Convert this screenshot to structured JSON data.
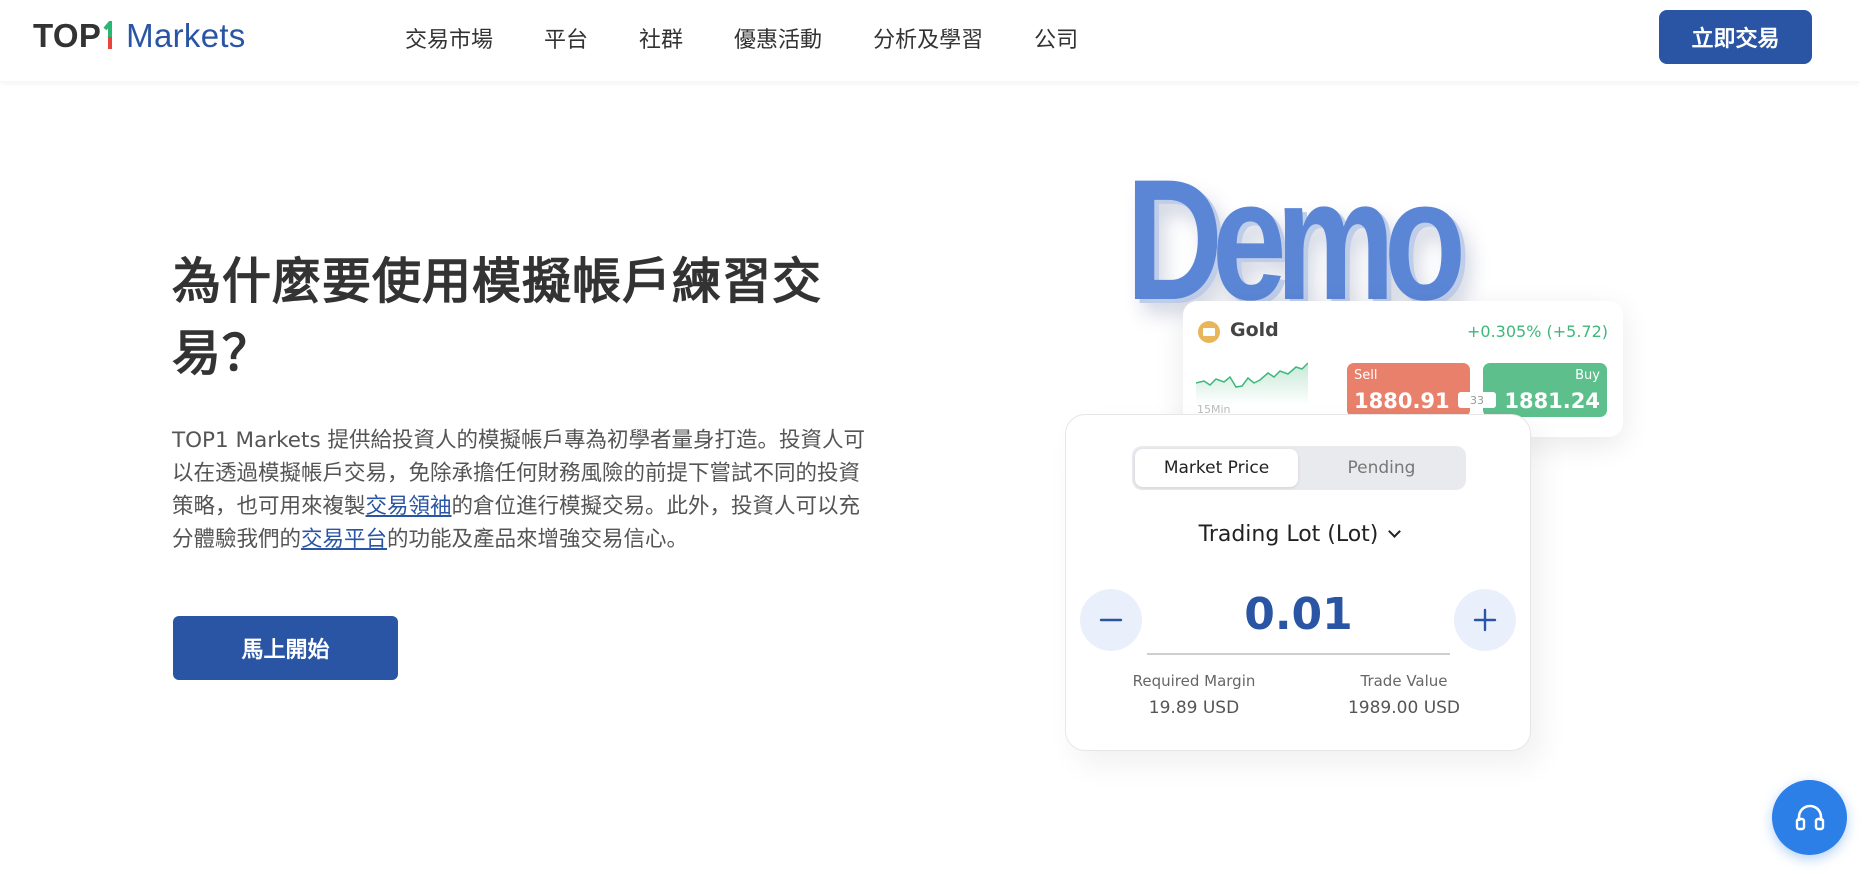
{
  "brand": {
    "top": "TOP",
    "markets": "Markets"
  },
  "nav": {
    "items": [
      {
        "label": "交易市場"
      },
      {
        "label": "平台"
      },
      {
        "label": "社群"
      },
      {
        "label": "優惠活動"
      },
      {
        "label": "分析及學習"
      },
      {
        "label": "公司"
      }
    ],
    "cta": "立即交易"
  },
  "hero": {
    "title": "為什麼要使用模擬帳戶練習交易？",
    "para_part1": "TOP1 Markets 提供給投資人的模擬帳戶專為初學者量身打造。投資人可以在透過模擬帳戶交易，免除承擔任何財務風險的前提下嘗試不同的投資策略，也可用來複製",
    "link1": "交易領袖",
    "para_part2": "的倉位進行模擬交易。此外，投資人可以充分體驗我們的",
    "link2": "交易平台",
    "para_part3": "的功能及產品來增強交易信心。",
    "start_button": "馬上開始"
  },
  "illustration": {
    "demo_word": "Demo",
    "quote": {
      "symbol": "Gold",
      "change": "+0.305% (+5.72)",
      "timeframe": "15Min",
      "sell_label": "Sell",
      "sell_price": "1880.91",
      "buy_label": "Buy",
      "buy_price": "1881.24",
      "spread": "33"
    },
    "order": {
      "tab_active": "Market Price",
      "tab_inactive": "Pending",
      "lot_label": "Trading Lot (Lot)",
      "lot_value": "0.01",
      "margin_label": "Required Margin",
      "margin_value": "19.89 USD",
      "trade_value_label": "Trade Value",
      "trade_value": "1989.00 USD"
    }
  },
  "colors": {
    "brand_blue": "#2a55a4",
    "sell": "#e8806b",
    "buy": "#5dbf8c",
    "positive": "#3db87a",
    "support": "#2b7fe6"
  },
  "icons": [
    "chevron-down-icon",
    "minus-icon",
    "plus-icon",
    "headset-icon",
    "gold-coin-icon"
  ]
}
